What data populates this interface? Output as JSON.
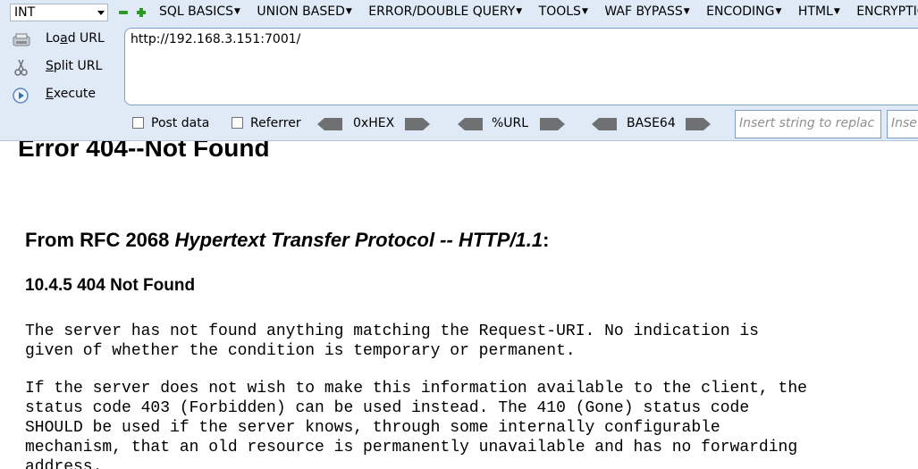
{
  "toolbar": {
    "select_value": "INT",
    "menu": [
      "SQL BASICS",
      "UNION BASED",
      "ERROR/DOUBLE QUERY",
      "TOOLS",
      "WAF BYPASS",
      "ENCODING",
      "HTML",
      "ENCRYPTIO"
    ],
    "load_url_prefix": "Lo",
    "load_url_u": "a",
    "load_url_rest": "d URL",
    "split_url_u": "S",
    "split_url_rest": "plit URL",
    "execute_u": "E",
    "execute_mid": "x",
    "execute_rest": "ecute",
    "url_value": "http://192.168.3.151:7001/",
    "post_data_label": "Post data",
    "referrer_label": "Referrer",
    "hex_label": "0xHEX",
    "url_enc_label": "%URL",
    "base64_label": "BASE64",
    "replace_placeholder": "Insert string to replac",
    "replace_with_placeholder": "Inse"
  },
  "page": {
    "title": "Error 404--Not Found",
    "rfc_prefix": "From RFC 2068 ",
    "rfc_italic": "Hypertext Transfer Protocol -- HTTP/1.1",
    "rfc_suffix": ":",
    "section": "10.4.5 404 Not Found",
    "para1": "The server has not found anything matching the Request-URI. No indication is\ngiven of whether the condition is temporary or permanent.",
    "para2": "If the server does not wish to make this information available to the client, the\nstatus code 403 (Forbidden) can be used instead. The 410 (Gone) status code\nSHOULD be used if the server knows, through some internally configurable\nmechanism, that an old resource is permanently unavailable and has no forwarding\naddress."
  },
  "colors": {
    "toolbar_bg": "#dfeaf6",
    "accent_green": "#2a9a25",
    "input_border": "#7fa0c4"
  }
}
